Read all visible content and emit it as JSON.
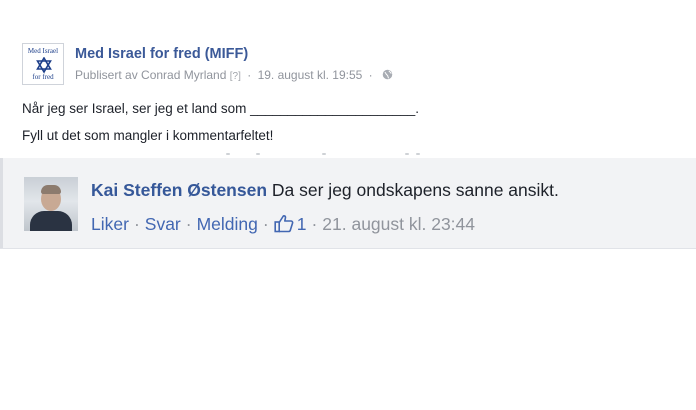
{
  "post": {
    "page_logo": {
      "line1": "Med Israel",
      "line2": "for fred"
    },
    "page_name": "Med Israel for fred (MIFF)",
    "meta": {
      "published_by": "Publisert av Conrad Myrland",
      "help_marker": "[?]",
      "separator": "·",
      "timestamp": "19. august kl. 19:55"
    },
    "text_line1": "Når jeg ser Israel, ser jeg et land som ______________________.",
    "text_line2": "Fyll ut det som mangler i kommentarfeltet!"
  },
  "comment": {
    "author": "Kai Steffen Østensen",
    "text": "Da ser jeg ondskapens sanne ansikt.",
    "actions": {
      "like": "Liker",
      "reply": "Svar",
      "message": "Melding",
      "separator": "·",
      "like_count": "1",
      "timestamp": "21. august kl. 23:44"
    }
  },
  "colors": {
    "link_blue": "#3b5998",
    "action_blue": "#4267b2",
    "meta_gray": "#90949c",
    "comment_bg": "#f2f3f5"
  },
  "icons": [
    "star-of-david-icon",
    "globe-icon",
    "thumbs-up-icon"
  ]
}
